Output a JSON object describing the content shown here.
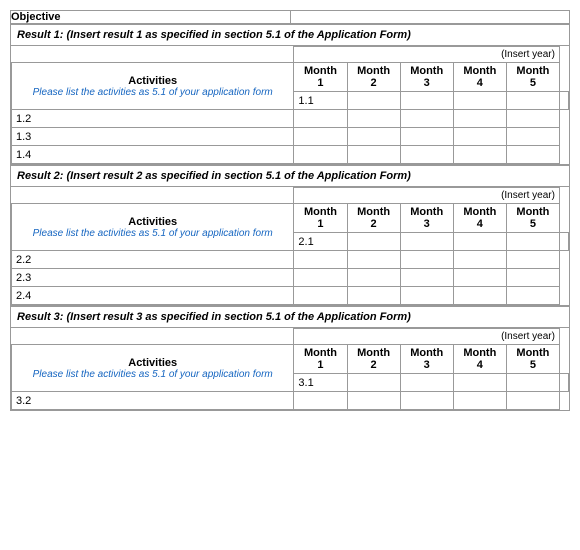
{
  "objective": {
    "label": "Objective",
    "value": ""
  },
  "results": [
    {
      "id": 1,
      "header": "Result 1: (Insert result 1 as specified in section 5.1 of the Application Form)",
      "insert_year": "(Insert year)",
      "activities_label": "Activities",
      "activities_subtext": "Please list the activities as 5.1 of your application form",
      "months": [
        {
          "label": "Month",
          "number": "1"
        },
        {
          "label": "Month",
          "number": "2"
        },
        {
          "label": "Month",
          "number": "3"
        },
        {
          "label": "Month",
          "number": "4"
        },
        {
          "label": "Month",
          "number": "5"
        }
      ],
      "rows": [
        "1.1",
        "1.2",
        "1.3",
        "1.4"
      ]
    },
    {
      "id": 2,
      "header": "Result 2: (Insert result 2 as specified in section 5.1 of the Application Form)",
      "insert_year": "(Insert year)",
      "activities_label": "Activities",
      "activities_subtext": "Please list the activities as 5.1 of your application form",
      "months": [
        {
          "label": "Month",
          "number": "1"
        },
        {
          "label": "Month",
          "number": "2"
        },
        {
          "label": "Month",
          "number": "3"
        },
        {
          "label": "Month",
          "number": "4"
        },
        {
          "label": "Month",
          "number": "5"
        }
      ],
      "rows": [
        "2.1",
        "2.2",
        "2.3",
        "2.4"
      ]
    },
    {
      "id": 3,
      "header": "Result 3: (Insert result 3 as specified in section 5.1 of the Application Form)",
      "insert_year": "(Insert year)",
      "activities_label": "Activities",
      "activities_subtext": "Please list the activities as 5.1 of your application form",
      "months": [
        {
          "label": "Month",
          "number": "1"
        },
        {
          "label": "Month",
          "number": "2"
        },
        {
          "label": "Month",
          "number": "3"
        },
        {
          "label": "Month",
          "number": "4"
        },
        {
          "label": "Month",
          "number": "5"
        }
      ],
      "rows": [
        "3.1",
        "3.2"
      ]
    }
  ]
}
